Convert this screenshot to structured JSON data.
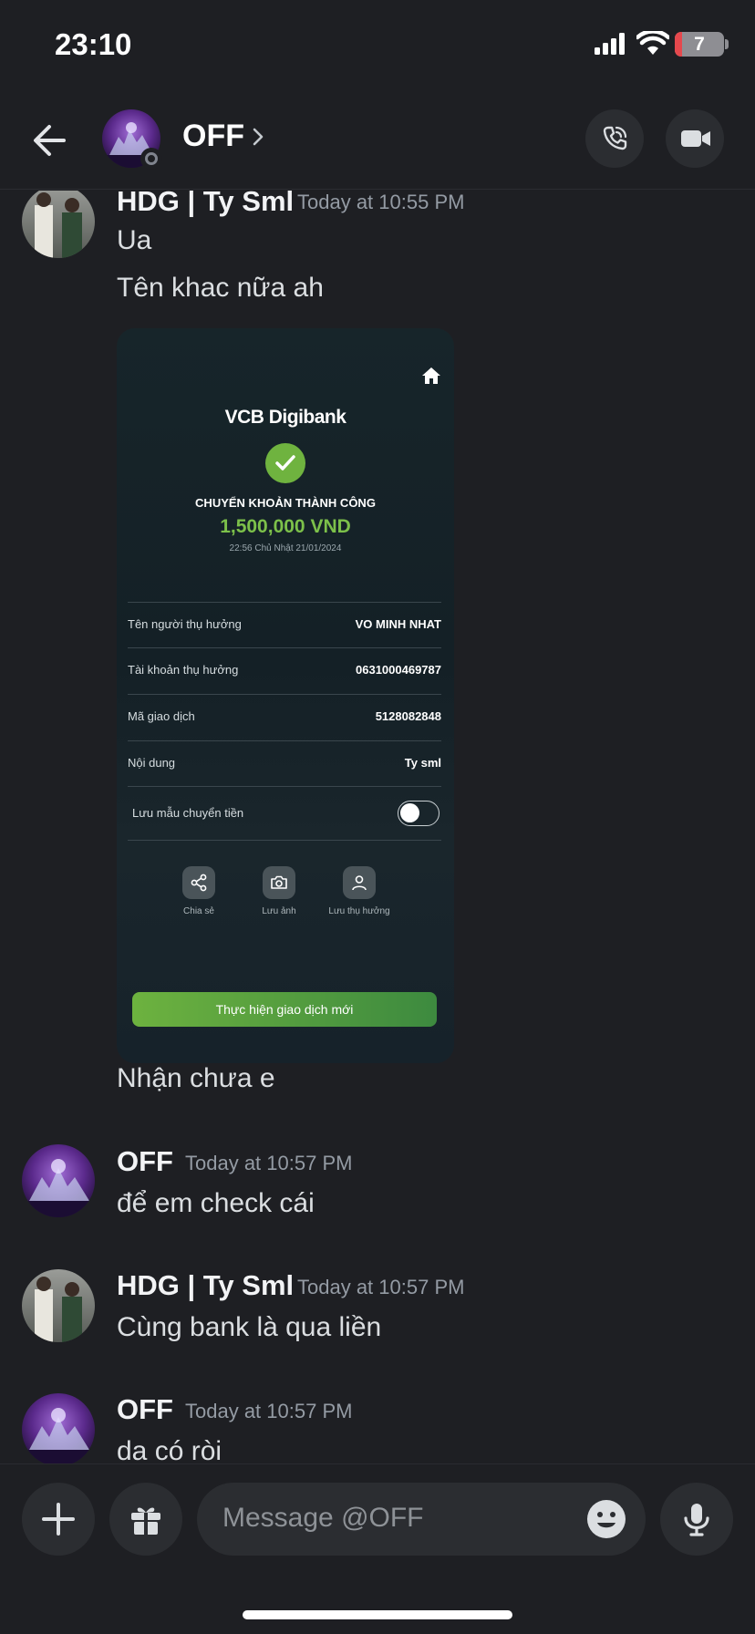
{
  "status_bar": {
    "time": "23:10",
    "battery": "7"
  },
  "header": {
    "name": "OFF"
  },
  "messages": [
    {
      "author": "HDG | Ty Sml",
      "timestamp": "Today at 10:55 PM",
      "lines": [
        "Ua",
        "Tên khac nữa ah"
      ],
      "after_image": "Nhận chưa e"
    },
    {
      "author": "OFF",
      "timestamp": "Today at 10:57 PM",
      "text": "để em check cái"
    },
    {
      "author": "HDG | Ty Sml",
      "timestamp": "Today at 10:57 PM",
      "text": "Cùng bank là qua liền"
    },
    {
      "author": "OFF",
      "timestamp": "Today at 10:57 PM",
      "text": "da có ròi"
    }
  ],
  "receipt": {
    "brand": "VCB Digibank",
    "status": "CHUYỂN KHOẢN THÀNH CÔNG",
    "amount": "1,500,000 VND",
    "datetime": "22:56 Chủ Nhật 21/01/2024",
    "rows": [
      {
        "label": "Tên người thụ hưởng",
        "value": "VO MINH NHAT"
      },
      {
        "label": "Tài khoản thụ hưởng",
        "value": "0631000469787"
      },
      {
        "label": "Mã giao dịch",
        "value": "5128082848"
      },
      {
        "label": "Nội dung",
        "value": "Ty sml"
      }
    ],
    "save_template_label": "Lưu mẫu chuyển tiền",
    "actions": [
      "Chia sẻ",
      "Lưu ảnh",
      "Lưu thụ hưởng"
    ],
    "new_transaction_label": "Thực hiện giao dịch mới"
  },
  "composer": {
    "placeholder": "Message @OFF"
  },
  "icons": {
    "back": "arrow-left-icon",
    "call": "phone-icon",
    "video": "video-camera-icon",
    "add": "plus-icon",
    "gift": "gift-icon",
    "emoji": "emoji-icon",
    "mic": "microphone-icon"
  }
}
